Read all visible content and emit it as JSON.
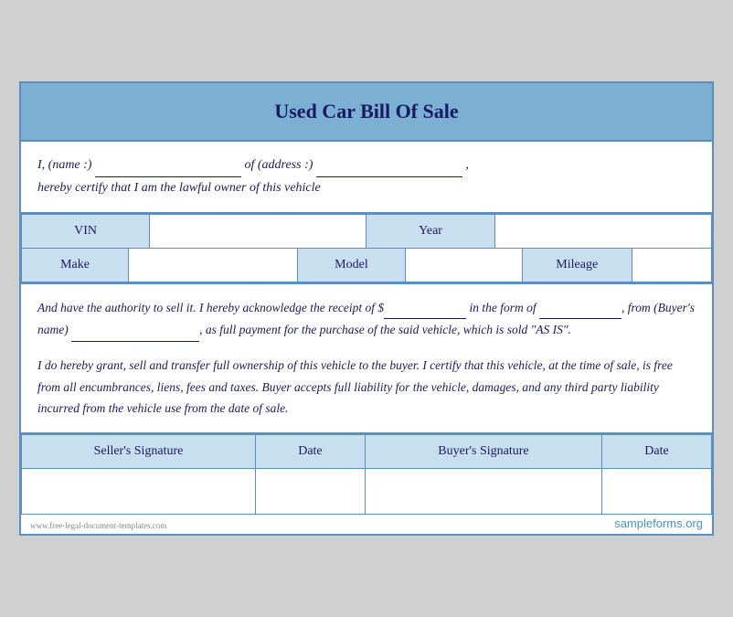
{
  "title": "Used Car Bill Of Sale",
  "intro": {
    "line1_pre": "I, (name :) ",
    "line1_mid": " of (address :) ",
    "line1_end": ",",
    "line2": "hereby certify that I am the lawful owner of this vehicle"
  },
  "vehicle_fields": {
    "row1": [
      {
        "label": "VIN",
        "value": ""
      },
      {
        "label": "Year",
        "value": ""
      }
    ],
    "row2": [
      {
        "label": "Make",
        "value": ""
      },
      {
        "label": "Model",
        "value": ""
      },
      {
        "label": "Mileage",
        "value": ""
      }
    ]
  },
  "body_paragraph1": "And have the authority to sell it. I hereby acknowledge the receipt of $",
  "body_paragraph1b": " in the form of ",
  "body_paragraph1c": ", from (Buyer's name) ",
  "body_paragraph1d": ", as full payment for the purchase of the said vehicle, which is sold \"AS IS\".",
  "body_paragraph2": "I do hereby grant, sell and transfer full ownership of this vehicle to the buyer. I certify that this vehicle, at the time of sale, is free from all encumbrances, liens, fees and taxes. Buyer accepts full liability for the vehicle, damages, and any third party liability incurred from the vehicle use from the date of sale.",
  "signature_row1": [
    {
      "label": "Seller's Signature"
    },
    {
      "label": "Date"
    },
    {
      "label": "Buyer's Signature"
    },
    {
      "label": "Date"
    }
  ],
  "watermark": "www.free-legal-document-templates.com",
  "sampleforms": "sampleforms.org"
}
